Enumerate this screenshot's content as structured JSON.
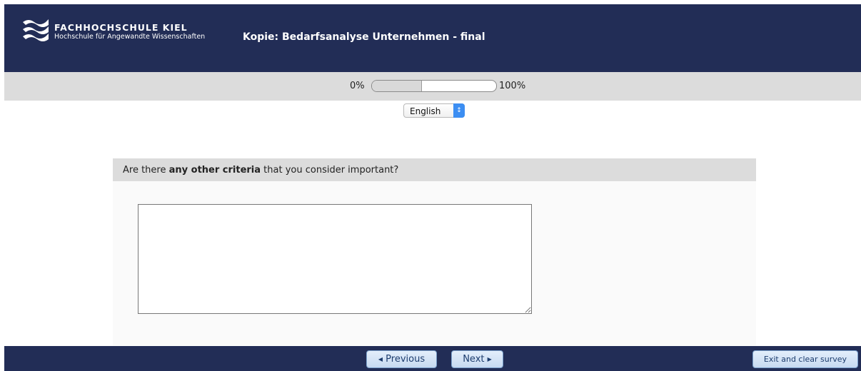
{
  "header": {
    "school_name": "FACHHOCHSCHULE KIEL",
    "school_subtitle": "Hochschule für Angewandte Wissenschaften",
    "survey_title": "Kopie: Bedarfsanalyse Unternehmen - final",
    "logo_icon": "fh-kiel-logo-icon"
  },
  "progress": {
    "start_label": "0%",
    "end_label": "100%",
    "value_percent": 40
  },
  "language": {
    "selected": "English",
    "icon": "updown-chevron-icon"
  },
  "question": {
    "prefix": "Are there ",
    "emphasis": "any other criteria",
    "suffix": " that you consider important?",
    "answer_value": ""
  },
  "navigation": {
    "previous_label": "Previous",
    "next_label": "Next",
    "exit_label": "Exit and clear survey",
    "previous_icon": "triangle-left-icon",
    "next_icon": "triangle-right-icon"
  },
  "colors": {
    "header_bg": "#222d56",
    "band_gray": "#dcdcdc",
    "button_bg": "#c7daf1",
    "select_accent": "#3c8ef2"
  }
}
